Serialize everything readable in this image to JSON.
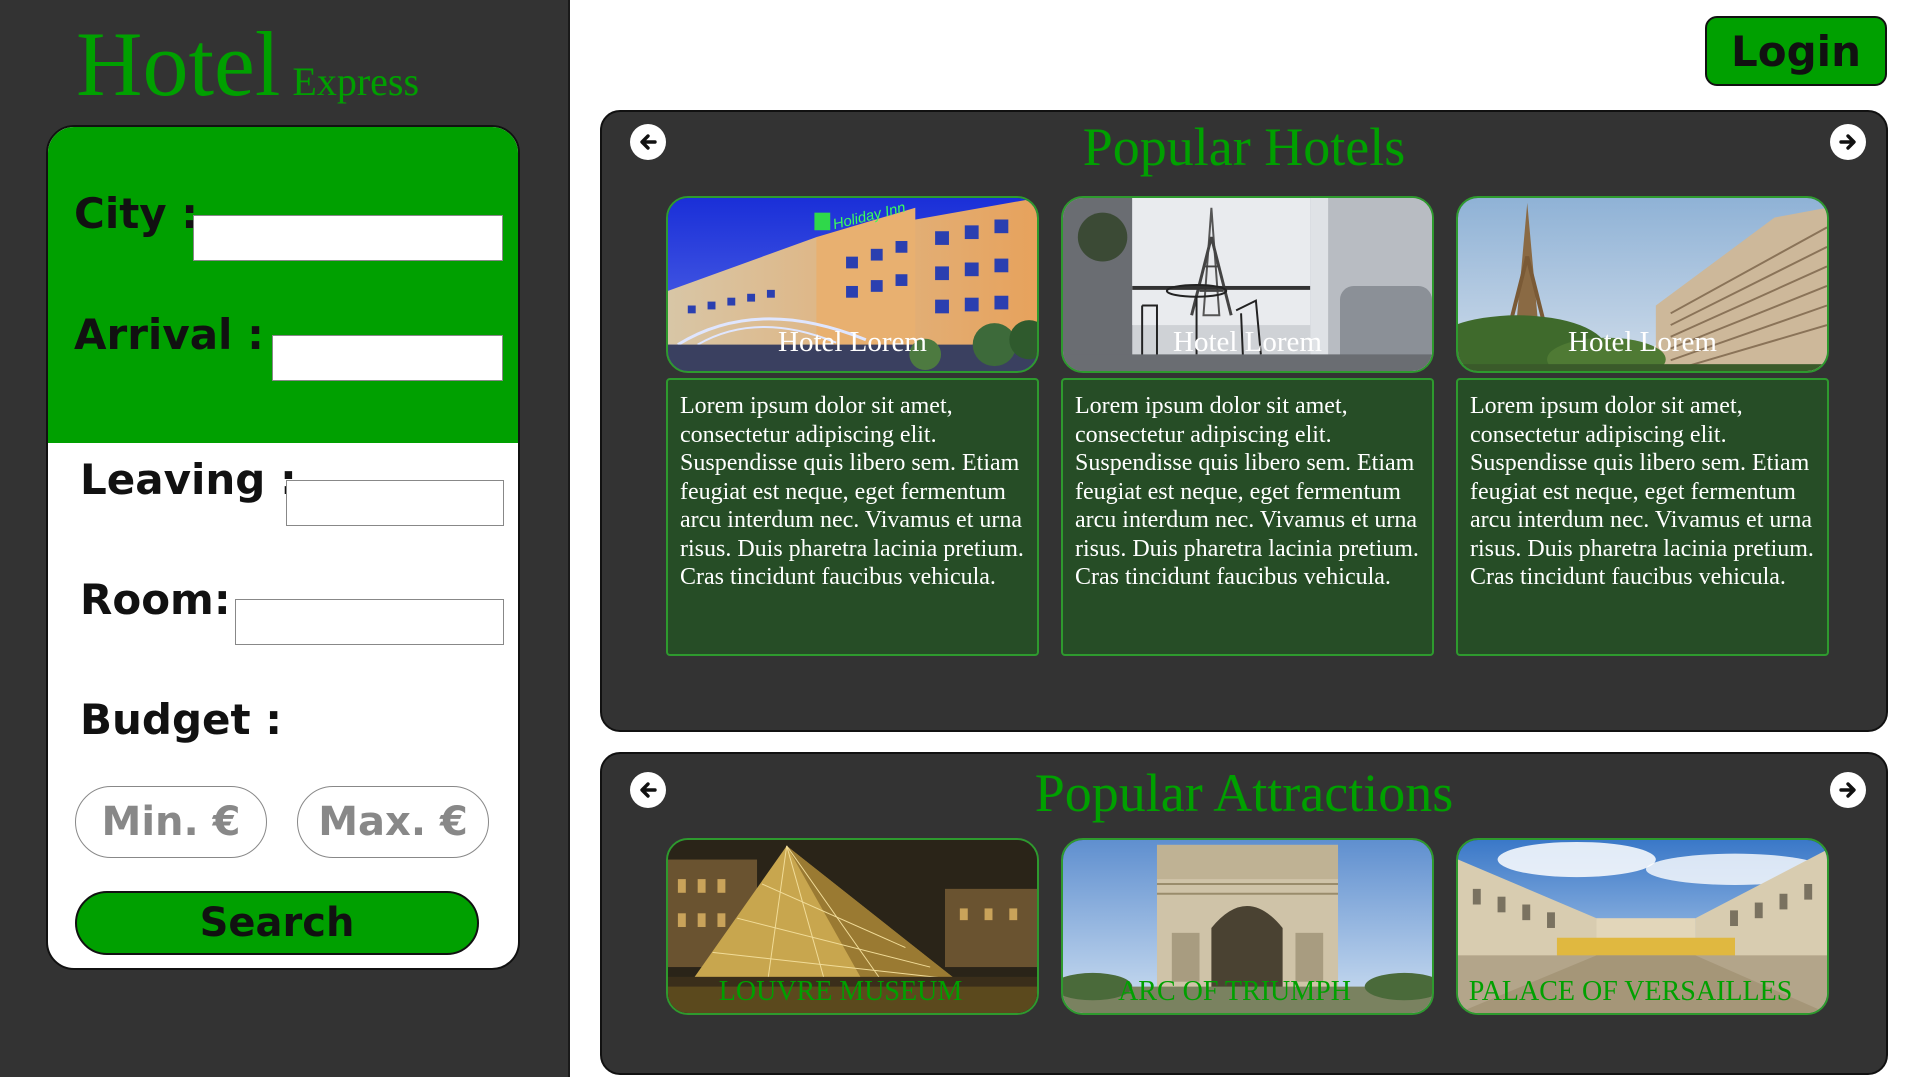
{
  "brand": {
    "main": "Hotel",
    "sub": "Express"
  },
  "search_form": {
    "city_label": "City :",
    "arrival_label": "Arrival :",
    "leaving_label": "Leaving :",
    "room_label": "Room:",
    "budget_label": "Budget :",
    "min_placeholder": "Min. €",
    "max_placeholder": "Max. €",
    "search_label": "Search"
  },
  "header": {
    "login_label": "Login"
  },
  "hotels": {
    "title": "Popular Hotels",
    "items": [
      {
        "name": "Hotel Lorem",
        "description": "Lorem ipsum dolor sit amet, consectetur adipiscing elit. Suspendisse quis libero sem. Etiam feugiat est neque, eget fermentum arcu interdum nec. Vivamus et urna risus. Duis pharetra lacinia pretium. Cras tincidunt faucibus vehicula."
      },
      {
        "name": "Hotel Lorem",
        "description": "Lorem ipsum dolor sit amet, consectetur adipiscing elit. Suspendisse quis libero sem. Etiam feugiat est neque, eget fermentum arcu interdum nec. Vivamus et urna risus. Duis pharetra lacinia pretium. Cras tincidunt faucibus vehicula."
      },
      {
        "name": "Hotel Lorem",
        "description": "Lorem ipsum dolor sit amet, consectetur adipiscing elit. Suspendisse quis libero sem. Etiam feugiat est neque, eget fermentum arcu interdum nec. Vivamus et urna risus. Duis pharetra lacinia pretium. Cras tincidunt faucibus vehicula."
      }
    ]
  },
  "attractions": {
    "title": "Popular Attractions",
    "items": [
      {
        "name": "LOUVRE MUSEUM"
      },
      {
        "name": "ARC OF TRIUMPH"
      },
      {
        "name": "PALACE OF VERSAILLES"
      }
    ]
  },
  "hotel1_sign": "Holiday Inn",
  "colors": {
    "accent": "#00a000",
    "panel_bg": "#333333",
    "desc_bg": "#264d26",
    "border_green": "#2e9a2e"
  }
}
